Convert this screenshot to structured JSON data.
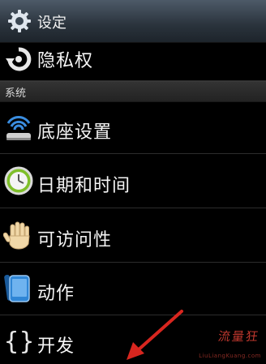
{
  "header": {
    "title": "设定",
    "icon": "gear-icon"
  },
  "items_top": [
    {
      "label": "隐私权",
      "icon": "privacy-refresh-icon"
    }
  ],
  "section": {
    "label": "系统"
  },
  "items": [
    {
      "label": "底座设置",
      "icon": "dock-icon"
    },
    {
      "label": "日期和时间",
      "icon": "clock-icon"
    },
    {
      "label": "可访问性",
      "icon": "hand-icon"
    },
    {
      "label": "动作",
      "icon": "phone-motion-icon"
    },
    {
      "label": "开发",
      "icon": "braces-icon"
    }
  ],
  "watermark": {
    "text": "流量狂",
    "url": "LiuLiangKuang.com"
  },
  "colors": {
    "title_bar": "#2e3842",
    "section_bar": "#2b2b2b",
    "arrow": "#d8261f",
    "background": "#000000"
  }
}
